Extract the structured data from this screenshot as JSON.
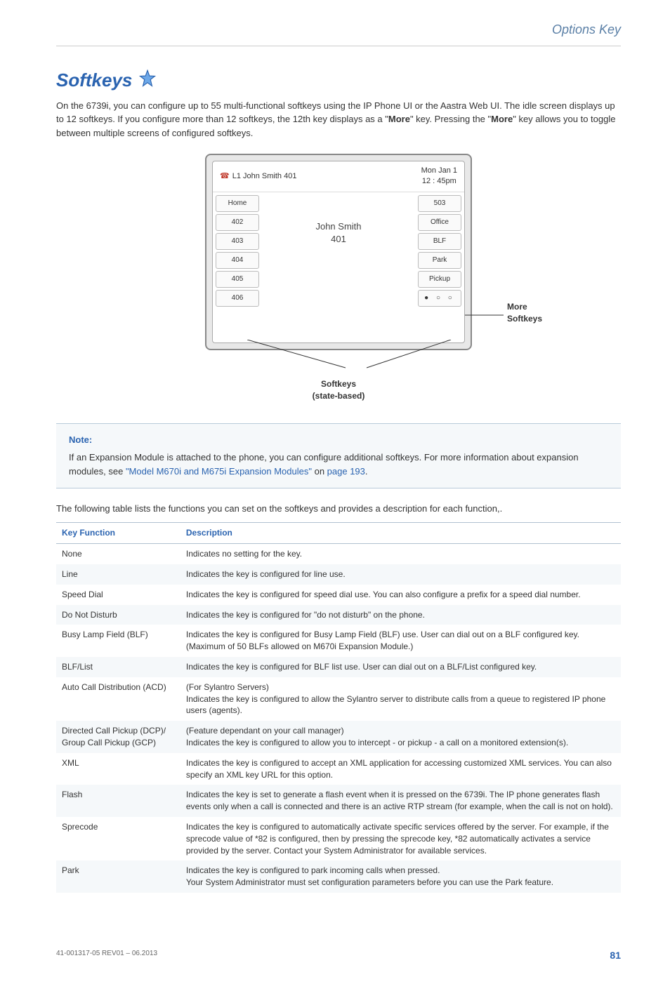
{
  "page": {
    "header": "Options Key",
    "title": "Softkeys",
    "intro_parts": [
      "On the 6739i, you can configure up to 55 multi-functional softkeys using the IP Phone UI or the Aastra Web UI. The idle screen displays up to 12 softkeys. If you configure more than 12 softkeys, the 12th key displays as a \"",
      "More",
      "\" key. Pressing the \"",
      "More",
      "\" key allows you to toggle between multiple screens of configured softkeys."
    ]
  },
  "phone": {
    "line_label": "L1 John Smith 401",
    "date": "Mon Jan 1",
    "time": "12 : 45pm",
    "center_name": "John Smith",
    "center_ext": "401",
    "left_keys": [
      "Home",
      "402",
      "403",
      "404",
      "405",
      "406"
    ],
    "right_keys": [
      "503",
      "Office",
      "BLF",
      "Park",
      "Pickup",
      "● ○ ○"
    ],
    "callout_more": "More Softkeys",
    "callout_bottom_1": "Softkeys",
    "callout_bottom_2": "(state-based)"
  },
  "note": {
    "title": "Note:",
    "text_before": "If an Expansion Module is attached to the phone, you can configure additional softkeys. For more information about expansion modules, see ",
    "link": "\"Model M670i and M675i Expansion Modules\"",
    "text_mid": " on ",
    "page_ref": "page 193",
    "text_after": "."
  },
  "table_intro": "The following table lists the functions you can set on the softkeys and provides a description for each function,.",
  "table": {
    "h1": "Key Function",
    "h2": "Description",
    "rows": [
      {
        "f": "None",
        "d": "Indicates no setting for the key."
      },
      {
        "f": "Line",
        "d": "Indicates the key is configured for line use."
      },
      {
        "f": "Speed Dial",
        "d": "Indicates the key is configured for speed dial use. You can also configure a prefix for a speed dial number."
      },
      {
        "f": "Do Not Disturb",
        "d": "Indicates the key is configured for \"do not disturb\" on the phone."
      },
      {
        "f": "Busy Lamp Field (BLF)",
        "d": "Indicates the key is configured for Busy Lamp Field (BLF) use. User can dial out on a BLF configured key. (Maximum of 50 BLFs allowed on M670i Expansion Module.)"
      },
      {
        "f": "BLF/List",
        "d": "Indicates the key is configured for BLF list use. User can dial out on a BLF/List configured key."
      },
      {
        "f": "Auto Call Distribution (ACD)",
        "d": "(For Sylantro Servers)\nIndicates the key is configured to allow the Sylantro server to distribute calls from a queue to registered IP phone users (agents)."
      },
      {
        "f": "Directed Call Pickup (DCP)/ Group Call Pickup (GCP)",
        "d": "(Feature dependant on your call manager)\nIndicates the key is configured to allow you to intercept - or pickup - a call on a monitored extension(s)."
      },
      {
        "f": "XML",
        "d": "Indicates the key is configured to accept an XML application for accessing customized XML services. You can also specify an XML key URL for this option."
      },
      {
        "f": "Flash",
        "d": "Indicates the key is set to generate a flash event when it is pressed on the 6739i. The IP phone generates flash events only when a call is connected and there is an active RTP stream (for example, when the call is not on hold)."
      },
      {
        "f": "Sprecode",
        "d": "Indicates the key is configured to automatically activate specific services offered by the server. For example, if the sprecode value of *82 is configured, then by pressing the sprecode key, *82 automatically activates a service provided by the server. Contact your System Administrator for available services."
      },
      {
        "f": "Park",
        "d": "Indicates the key is configured to park incoming calls when pressed.\nYour System Administrator must set configuration parameters before you can use the Park feature."
      }
    ]
  },
  "footer": {
    "left": "41-001317-05 REV01 – 06.2013",
    "page": "81"
  }
}
